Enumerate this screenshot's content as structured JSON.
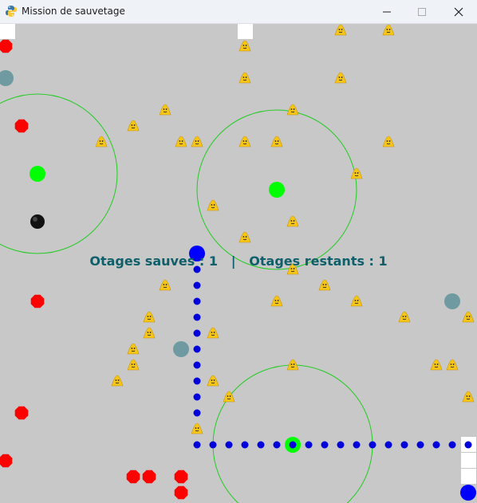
{
  "window": {
    "title": "Mission de sauvetage",
    "icon": "python-icon",
    "minimize_icon": "minimize-icon",
    "maximize_icon": "maximize-icon",
    "close_icon": "close-icon"
  },
  "hud": {
    "saved_label": "Otages sauves : 1",
    "separator": "|",
    "remaining_label": "Otages restants : 1"
  },
  "colors": {
    "background": "#c8c8c8",
    "enemy": "#ff0000",
    "player": "#0000ff",
    "trail": "#0000dd",
    "radar_zone": "#22cc22",
    "radar_center": "#00ff00",
    "neutral": "#6f9aa2",
    "hostage": "#f5c518",
    "text": "#0f5f6a"
  }
}
